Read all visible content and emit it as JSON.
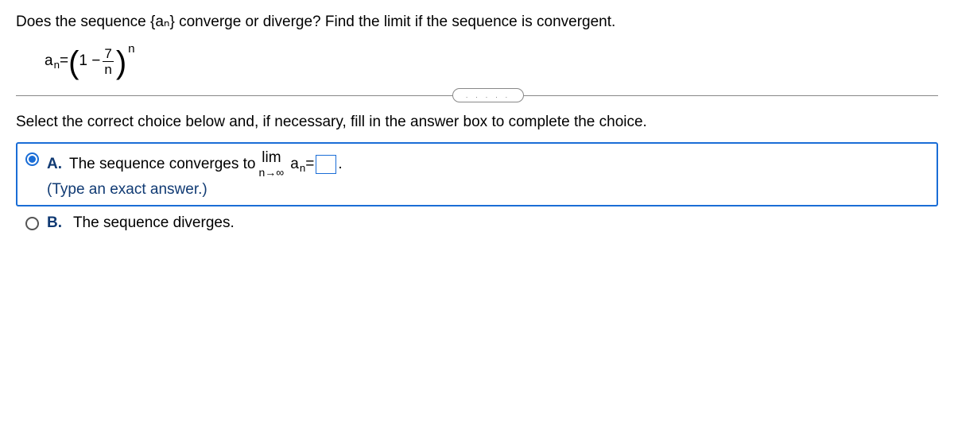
{
  "question": "Does the sequence {aₙ} converge or diverge? Find the limit if the sequence is convergent.",
  "formula": {
    "lhs_base": "a",
    "lhs_sub": "n",
    "eq": " = ",
    "inner_lead": "1 − ",
    "frac_num": "7",
    "frac_den": "n",
    "exp": "n"
  },
  "divider_dots": ". . . . .",
  "instruction": "Select the correct choice below and, if necessary, fill in the answer box to complete the choice.",
  "choices": {
    "A": {
      "label": "A.",
      "text_pre": "The sequence converges to ",
      "lim_top": "lim",
      "lim_bot": "n→∞",
      "an_base": "a",
      "an_sub": "n",
      "eq": " = ",
      "period": ".",
      "hint": "(Type an exact answer.)",
      "selected": true
    },
    "B": {
      "label": "B.",
      "text": "The sequence diverges.",
      "selected": false
    }
  }
}
